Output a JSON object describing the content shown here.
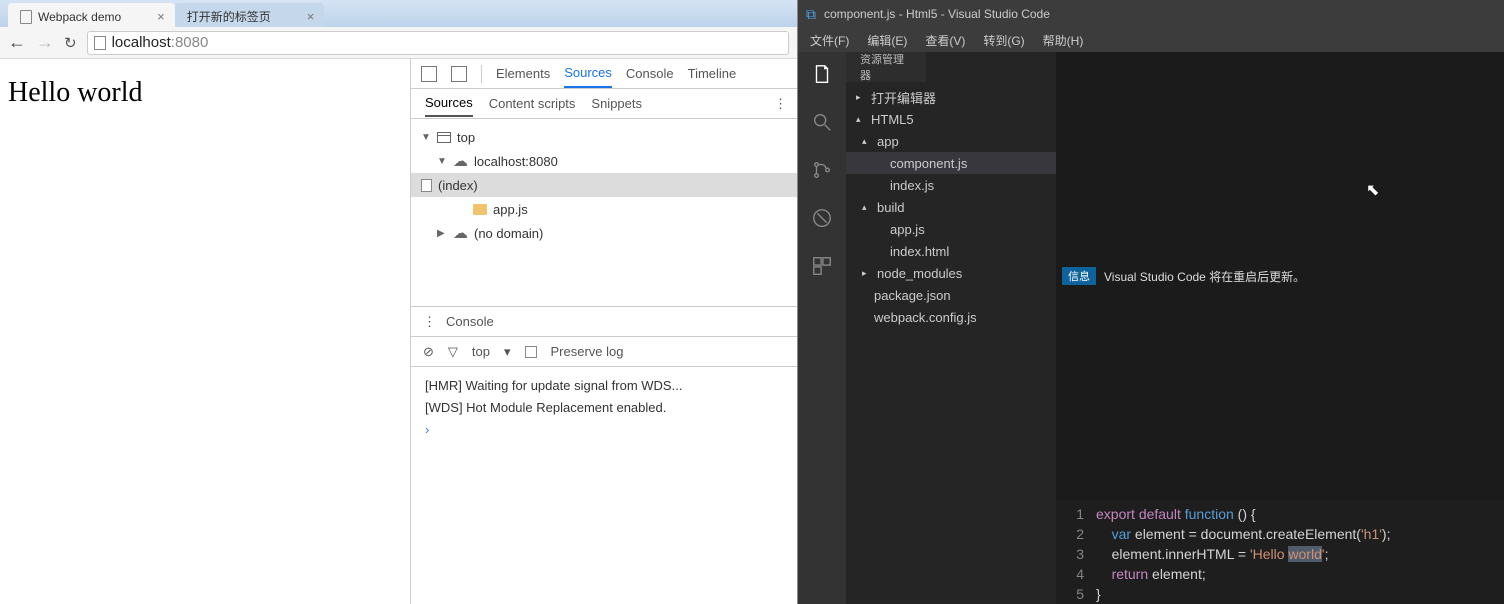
{
  "chrome": {
    "tabs": [
      {
        "label": "Webpack demo",
        "active": true
      },
      {
        "label": "打开新的标签页",
        "active": false
      }
    ],
    "url": {
      "host": "localhost",
      "port": ":8080"
    },
    "page_text": "Hello world",
    "devtools": {
      "main_tabs": [
        "Elements",
        "Sources",
        "Console",
        "Timeline"
      ],
      "main_active": "Sources",
      "sub_tabs": [
        "Sources",
        "Content scripts",
        "Snippets"
      ],
      "sub_active": "Sources",
      "tree": {
        "top": "top",
        "host": "localhost:8080",
        "files": [
          "(index)",
          "app.js"
        ],
        "nodomain": "(no domain)"
      },
      "console_label": "Console",
      "filter_scope": "top",
      "preserve_log": "Preserve log",
      "console_lines": [
        "[HMR] Waiting for update signal from WDS...",
        "[WDS] Hot Module Replacement enabled."
      ]
    }
  },
  "vscode": {
    "title": "component.js - Html5 - Visual Studio Code",
    "menu": [
      "文件(F)",
      "编辑(E)",
      "查看(V)",
      "转到(G)",
      "帮助(H)"
    ],
    "explorer_title": "资源管理器",
    "notification": {
      "badge": "信息",
      "text": "Visual Studio Code 将在重启后更新。"
    },
    "tree": {
      "open_editors": "打开编辑器",
      "root": "HTML5",
      "folders": {
        "app": "app",
        "app_files": [
          "component.js",
          "index.js"
        ],
        "build": "build",
        "build_files": [
          "app.js",
          "index.html"
        ],
        "node_modules": "node_modules",
        "root_files": [
          "package.json",
          "webpack.config.js"
        ]
      }
    },
    "code": {
      "line_numbers": [
        "1",
        "2",
        "3",
        "4",
        "5"
      ],
      "l1": {
        "a": "export",
        "b": "default",
        "c": "function",
        "d": " () {"
      },
      "l2": {
        "a": "var",
        "b": " element = document.createElement(",
        "c": "'h1'",
        "d": ");"
      },
      "l3": {
        "a": "element.innerHTML = ",
        "b": "'Hello ",
        "c": "world",
        "d": "'",
        "e": ";"
      },
      "l4": {
        "a": "return",
        "b": " element;"
      },
      "l5": "}"
    }
  }
}
